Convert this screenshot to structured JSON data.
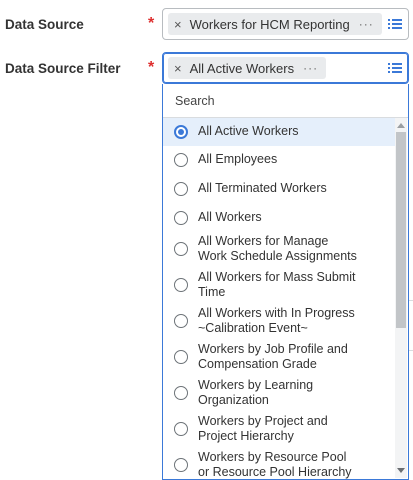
{
  "fields": {
    "data_source": {
      "label": "Data Source",
      "required_mark": "*",
      "value": "Workers for HCM Reporting",
      "remove_glyph": "×",
      "more_glyph": "···"
    },
    "data_source_filter": {
      "label": "Data Source Filter",
      "required_mark": "*",
      "value": "All Active Workers",
      "remove_glyph": "×",
      "more_glyph": "···"
    }
  },
  "dropdown": {
    "search_label": "Search",
    "options": [
      {
        "label": "All Active Workers",
        "selected": true
      },
      {
        "label": "All Employees",
        "selected": false
      },
      {
        "label": "All Terminated Workers",
        "selected": false
      },
      {
        "label": "All Workers",
        "selected": false
      },
      {
        "label": "All Workers for Manage Work Schedule Assignments",
        "selected": false
      },
      {
        "label": "All Workers for Mass Submit Time",
        "selected": false
      },
      {
        "label": "All Workers with In Progress ~Calibration Event~",
        "selected": false
      },
      {
        "label": "Workers by Job Profile and Compensation Grade",
        "selected": false
      },
      {
        "label": "Workers by Learning Organization",
        "selected": false
      },
      {
        "label": "Workers by Project and Project Hierarchy",
        "selected": false
      },
      {
        "label": "Workers by Resource Pool or Resource Pool Hierarchy",
        "selected": false
      }
    ]
  },
  "colors": {
    "accent": "#3b79d8",
    "required": "#de2f2f",
    "selected_row": "#e5effb"
  },
  "icons": {
    "prompt_list": "list-icon",
    "remove": "close-icon",
    "more": "more-icon",
    "radio": "radio-icon"
  }
}
